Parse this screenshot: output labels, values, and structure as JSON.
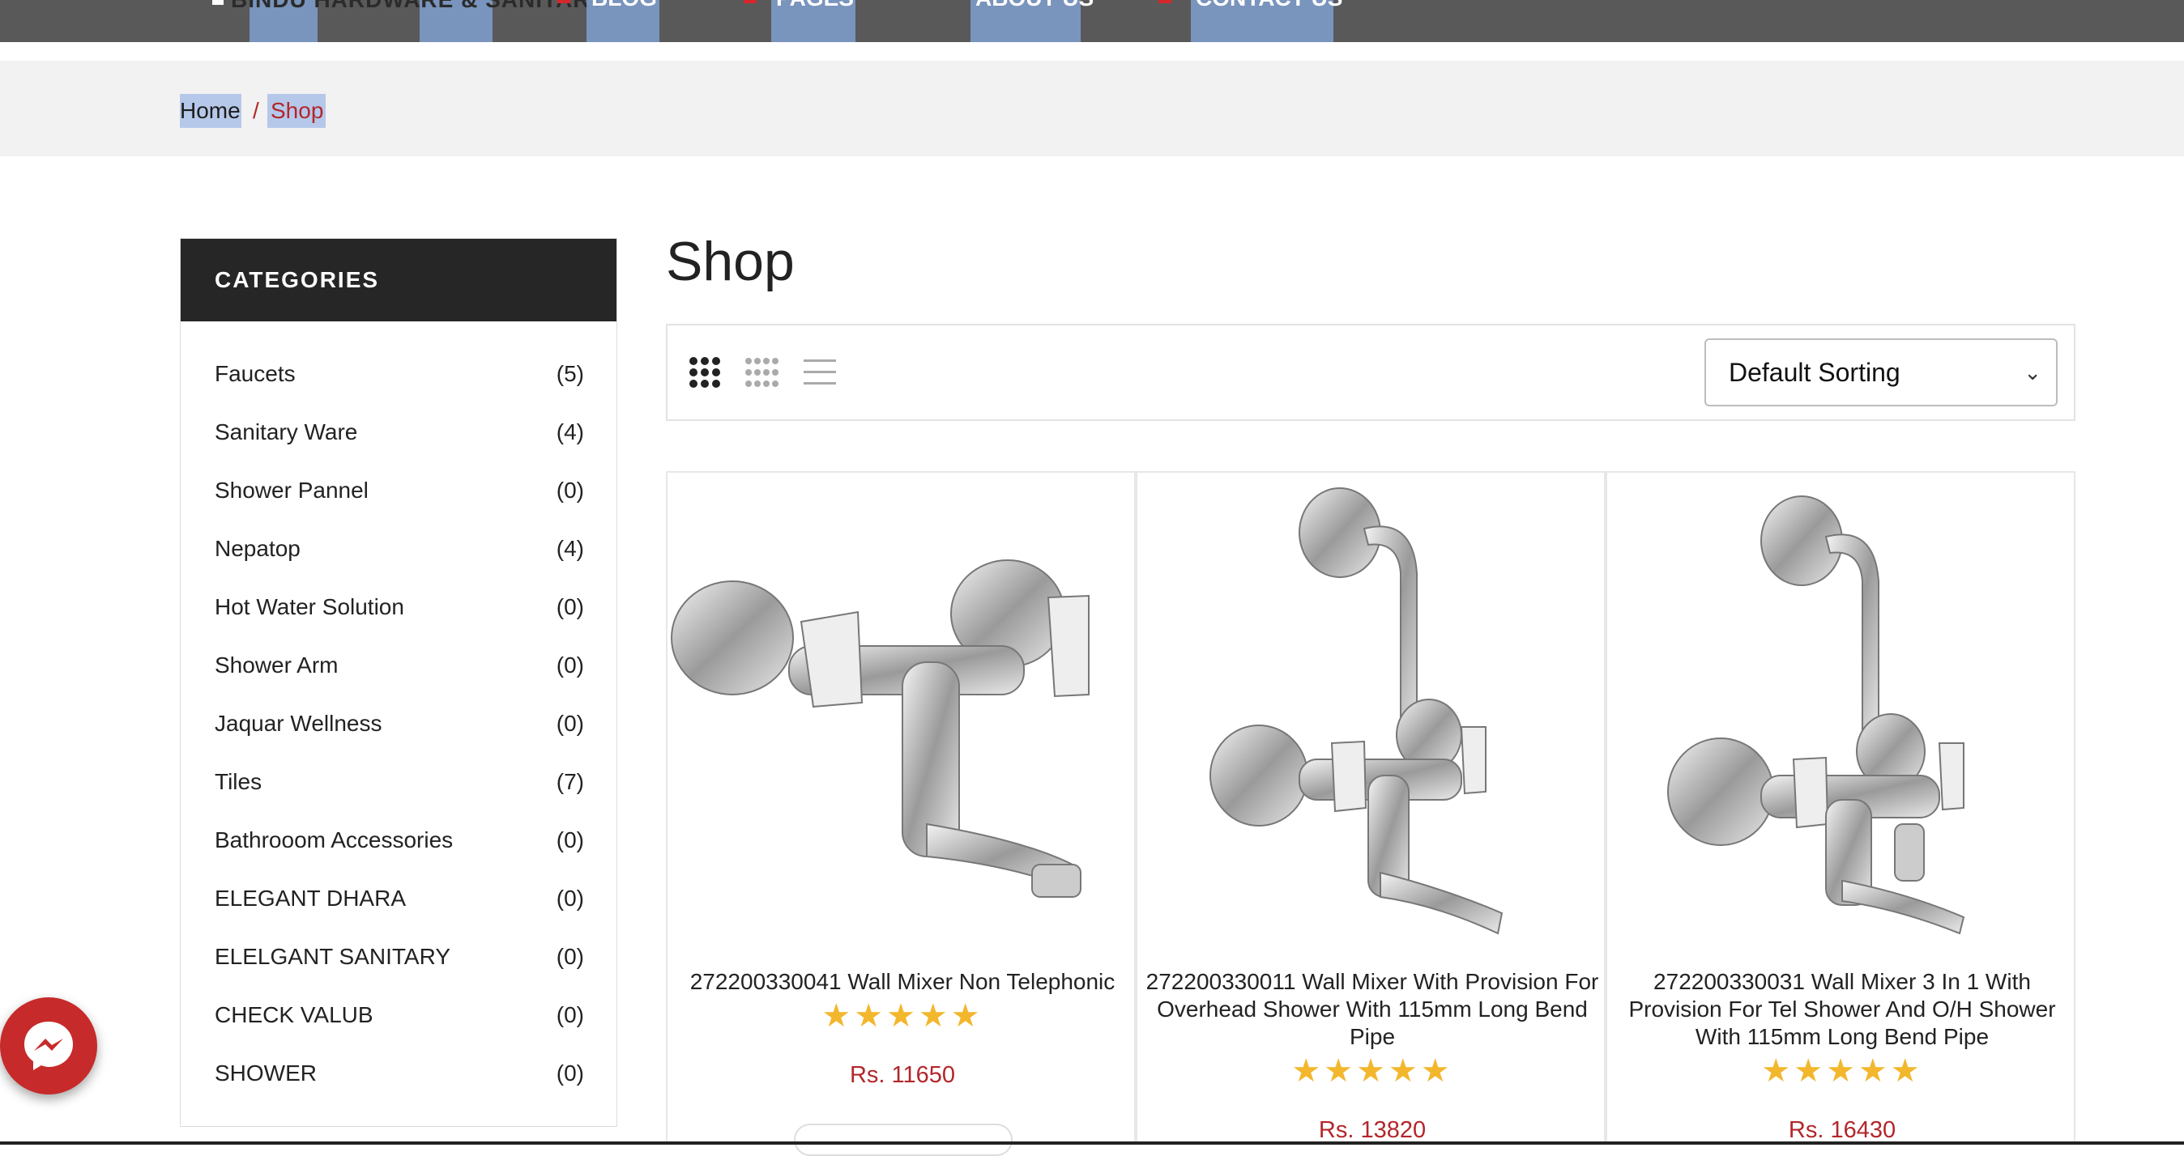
{
  "topbar": {
    "brand": "BINDU HARDWARE & SANITARY",
    "nav": [
      "BLOG",
      "PAGES",
      "ABOUT US",
      "CONTACT US"
    ]
  },
  "breadcrumb": {
    "home": "Home",
    "separator": "/",
    "current": "Shop"
  },
  "sidebar": {
    "title": "CATEGORIES",
    "items": [
      {
        "label": "Faucets",
        "count": "(5)"
      },
      {
        "label": "Sanitary Ware",
        "count": "(4)"
      },
      {
        "label": "Shower Pannel",
        "count": "(0)"
      },
      {
        "label": "Nepatop",
        "count": "(4)"
      },
      {
        "label": "Hot Water Solution",
        "count": "(0)"
      },
      {
        "label": "Shower Arm",
        "count": "(0)"
      },
      {
        "label": "Jaquar Wellness",
        "count": "(0)"
      },
      {
        "label": "Tiles",
        "count": "(7)"
      },
      {
        "label": "Bathrooom Accessories",
        "count": "(0)"
      },
      {
        "label": "ELEGANT DHARA",
        "count": "(0)"
      },
      {
        "label": "ELELGANT SANITARY",
        "count": "(0)"
      },
      {
        "label": "CHECK VALUB",
        "count": "(0)"
      },
      {
        "label": "SHOWER",
        "count": "(0)"
      }
    ]
  },
  "main": {
    "title": "Shop",
    "sort": {
      "selected": "Default Sorting"
    },
    "colors": {
      "accent": "#b3262b",
      "star": "#f2b72d",
      "header": "#262626"
    },
    "products": [
      {
        "name": "272200330041 Wall Mixer Non Telephonic",
        "rating": 5,
        "stars": "★★★★★",
        "price": "Rs. 11650"
      },
      {
        "name": "272200330011 Wall Mixer With Provision For Overhead Shower With 115mm Long Bend Pipe",
        "rating": 5,
        "stars": "★★★★★",
        "price": "Rs. 13820"
      },
      {
        "name": "272200330031 Wall Mixer 3 In 1 With Provision For Tel Shower And O/H Shower With 115mm Long Bend Pipe",
        "rating": 5,
        "stars": "★★★★★",
        "price": "Rs. 16430"
      }
    ]
  }
}
